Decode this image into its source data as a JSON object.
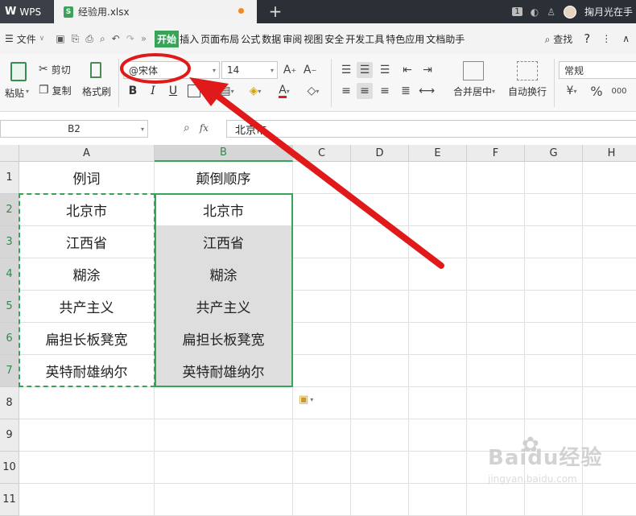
{
  "titlebar": {
    "app_name": "WPS",
    "file_name": "经验用.xlsx",
    "badge": "1",
    "user": "掬月光在手"
  },
  "menu": {
    "file_label": "文件",
    "tabs": [
      "开始",
      "插入",
      "页面布局",
      "公式",
      "数据",
      "审阅",
      "视图",
      "安全",
      "开发工具",
      "特色应用",
      "文档助手"
    ],
    "active_tab": "开始",
    "search_label": "查找",
    "help_label": "?"
  },
  "ribbon": {
    "paste_label": "粘贴",
    "cut_label": "剪切",
    "copy_label": "复制",
    "format_painter_label": "格式刷",
    "font_name": "@宋体",
    "font_size": "14",
    "merge_label": "合并居中",
    "wrap_label": "自动换行",
    "number_format": "常规"
  },
  "formula_bar": {
    "cell_ref": "B2",
    "fx_label": "fx",
    "value": "北京市"
  },
  "sheet": {
    "columns": [
      "A",
      "B",
      "C",
      "D",
      "E",
      "F",
      "G",
      "H"
    ],
    "rows": [
      "1",
      "2",
      "3",
      "4",
      "5",
      "6",
      "7",
      "8",
      "9",
      "10",
      "11"
    ],
    "col_a": [
      "例词",
      "北京市",
      "江西省",
      "糊涂",
      "共产主义",
      "扁担长板凳宽",
      "英特耐雄纳尔"
    ],
    "col_b": [
      "颠倒顺序",
      "北京市",
      "江西省",
      "糊涂",
      "共产主义",
      "扁担长板凳宽",
      "英特耐雄纳尔"
    ]
  },
  "accent": "#3aa35a",
  "annotation_color": "#e01a1a",
  "watermark": {
    "text": "Baidu经验",
    "url": "jingyan.baidu.com"
  }
}
